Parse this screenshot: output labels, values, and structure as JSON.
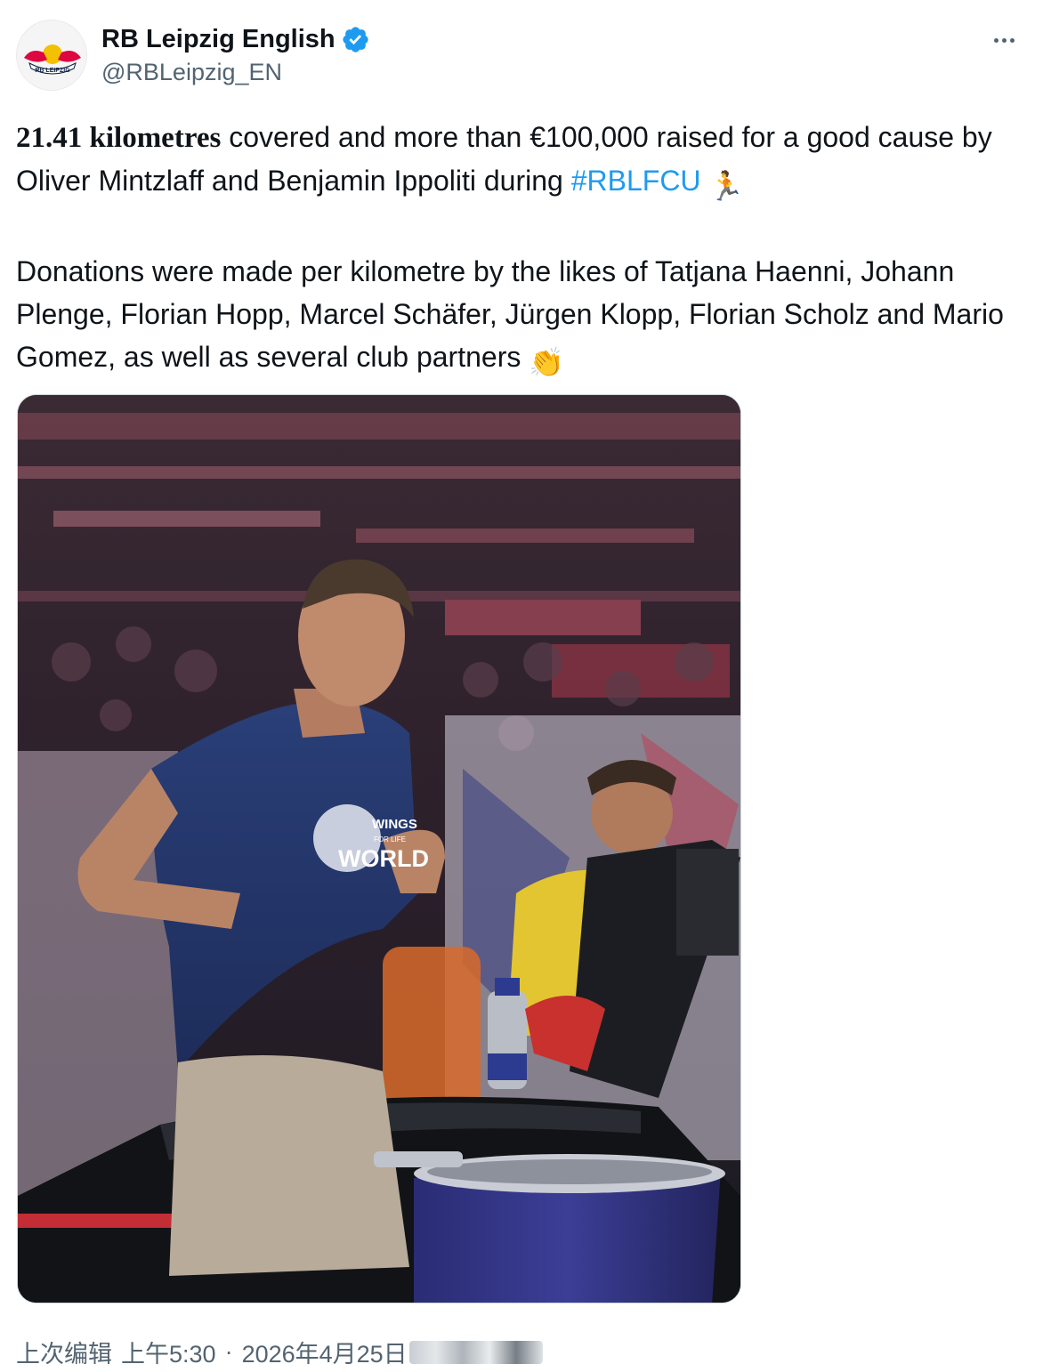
{
  "author": {
    "display_name": "RB Leipzig English",
    "handle": "@RBLeipzig_EN",
    "verified": true,
    "avatar_logo_text": "RB LEIPZIG",
    "avatar_icon": "rb-leipzig-bulls-logo"
  },
  "more_icon": "more-horizontal-icon",
  "tweet": {
    "line1_bold": "21.41 kilometres",
    "line1_rest": " covered and more than €100,000 raised for a good cause by Oliver Mintzlaff and Benjamin Ippoliti during ",
    "hashtag": "#RBLFCU",
    "emoji_runner": "🏃",
    "paragraph2": "Donations were made per kilometre by the likes of Tatjana Haenni, Johann Plenge, Florian Hopp, Marcel Schäfer, Jürgen Klopp, Florian Scholz and Mario Gomez, as well as several club partners ",
    "emoji_clap": "👏"
  },
  "media": {
    "shirt_text_top": "WINGS",
    "shirt_text_mid": "FOR LIFE",
    "shirt_text_bottom": "WORLD",
    "description_icon": "photo-treadmill-runner"
  },
  "footer": {
    "edited_label": "上次编辑",
    "time": "上午5:30",
    "separator": "·",
    "date": "2026年4月25日"
  },
  "colors": {
    "text": "#0f1419",
    "secondary": "#536471",
    "link": "#1d9bf0",
    "verified": "#1d9bf0"
  }
}
